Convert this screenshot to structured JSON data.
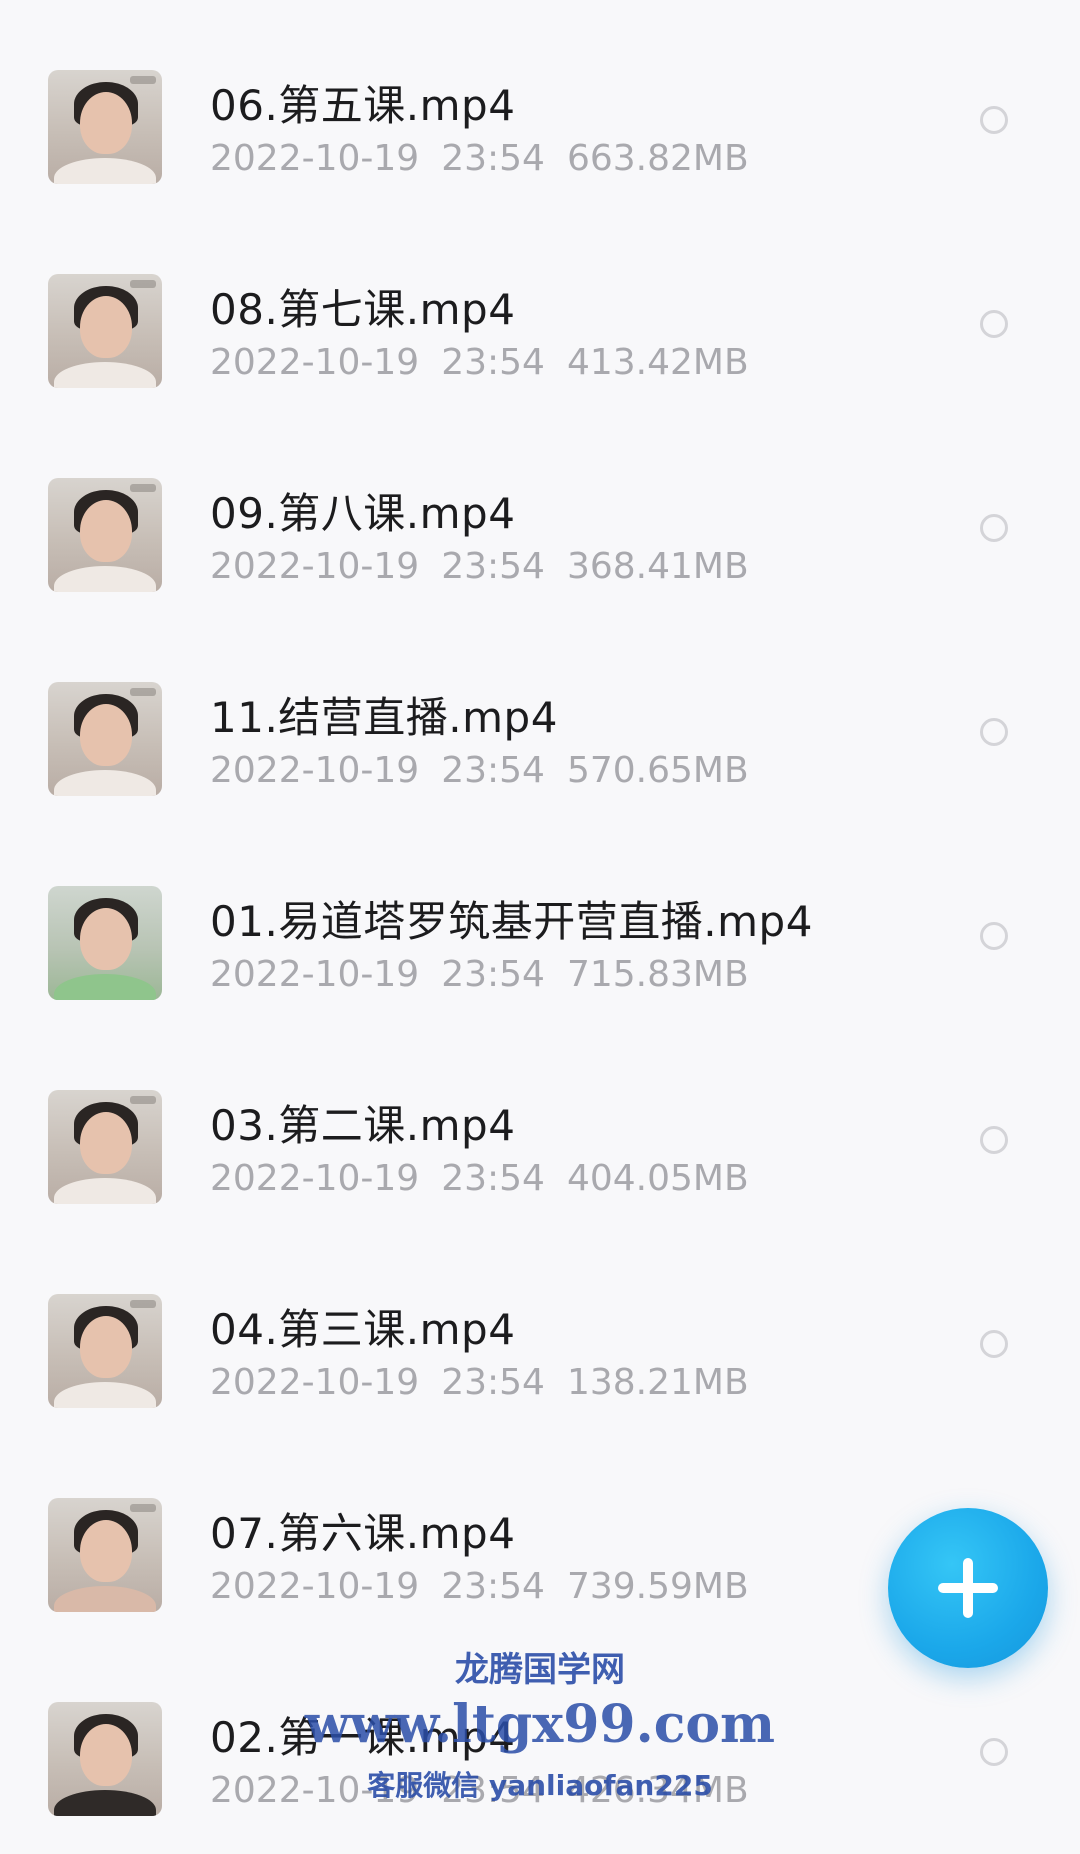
{
  "files": [
    {
      "name": "06.第五课.mp4",
      "date": "2022-10-19",
      "time": "23:54",
      "size": "663.82MB"
    },
    {
      "name": "08.第七课.mp4",
      "date": "2022-10-19",
      "time": "23:54",
      "size": "413.42MB"
    },
    {
      "name": "09.第八课.mp4",
      "date": "2022-10-19",
      "time": "23:54",
      "size": "368.41MB"
    },
    {
      "name": "11.结营直播.mp4",
      "date": "2022-10-19",
      "time": "23:54",
      "size": "570.65MB"
    },
    {
      "name": "01.易道塔罗筑基开营直播.mp4",
      "date": "2022-10-19",
      "time": "23:54",
      "size": "715.83MB"
    },
    {
      "name": "03.第二课.mp4",
      "date": "2022-10-19",
      "time": "23:54",
      "size": "404.05MB"
    },
    {
      "name": "04.第三课.mp4",
      "date": "2022-10-19",
      "time": "23:54",
      "size": "138.21MB"
    },
    {
      "name": "07.第六课.mp4",
      "date": "2022-10-19",
      "time": "23:54",
      "size": "739.59MB"
    },
    {
      "name": "02.第一课.mp4",
      "date": "2022-10-19",
      "time": "23:54",
      "size": "426.34MB"
    }
  ],
  "fab": {
    "icon": "plus-icon",
    "color": "#1ba8ea"
  },
  "watermark": {
    "title": "龙腾国学网",
    "url": "www.ltgx99.com",
    "contact": "客服微信 yanliaofan225"
  },
  "colors": {
    "background": "#f8f8fa",
    "name_text": "#1c1c1e",
    "meta_text": "#a9a9ae",
    "radio_border": "#d4d4d8",
    "watermark": "#2b4ea8"
  }
}
